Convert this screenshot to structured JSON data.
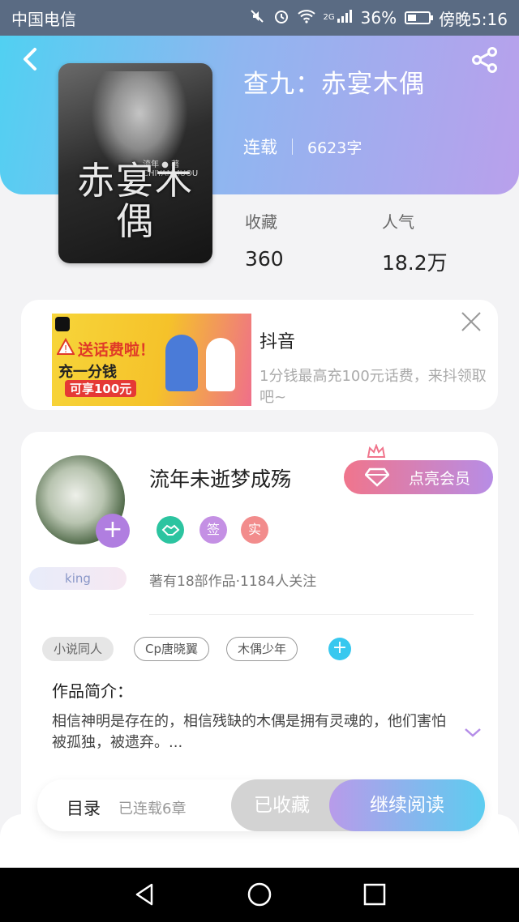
{
  "status_bar": {
    "carrier": "中国电信",
    "network": "2G",
    "battery": "36%",
    "time": "傍晚5:16"
  },
  "book": {
    "title": "查九：赤宴木偶",
    "status": "连载",
    "word_count": "6623字",
    "cover_title": "赤宴木偶",
    "cover_author": "流年 ● 著 CHIYANMUOU"
  },
  "stats": {
    "favorites_label": "收藏",
    "favorites_value": "360",
    "popularity_label": "人气",
    "popularity_value": "18.2万"
  },
  "ad": {
    "name": "抖音",
    "description": "1分钱最高充100元话费，来抖领取吧~",
    "image_line1": "送话费啦！",
    "image_line2": "充一分钱",
    "image_line3": "可享100元"
  },
  "author": {
    "name": "流年未逝梦成殇",
    "vip_button": "点亮会员",
    "tag": "king",
    "badges": [
      "",
      "签",
      "实"
    ],
    "stats": "著有18部作品·1184人关注"
  },
  "tags": [
    "小说同人",
    "Cp唐晓翼",
    "木偶少年"
  ],
  "intro": {
    "heading": "作品简介：",
    "text": "相信神明是存在的，相信残缺的木偶是拥有灵魂的，他们害怕被孤独，被遗弃。..."
  },
  "bottom_bar": {
    "toc_label": "目录",
    "toc_count": "已连载6章",
    "collected_label": "已收藏",
    "read_label": "继续阅读"
  },
  "colors": {
    "accent_cyan": "#4fd1f2",
    "accent_purple": "#b9a0ec",
    "vip_pink": "#f0758c"
  }
}
